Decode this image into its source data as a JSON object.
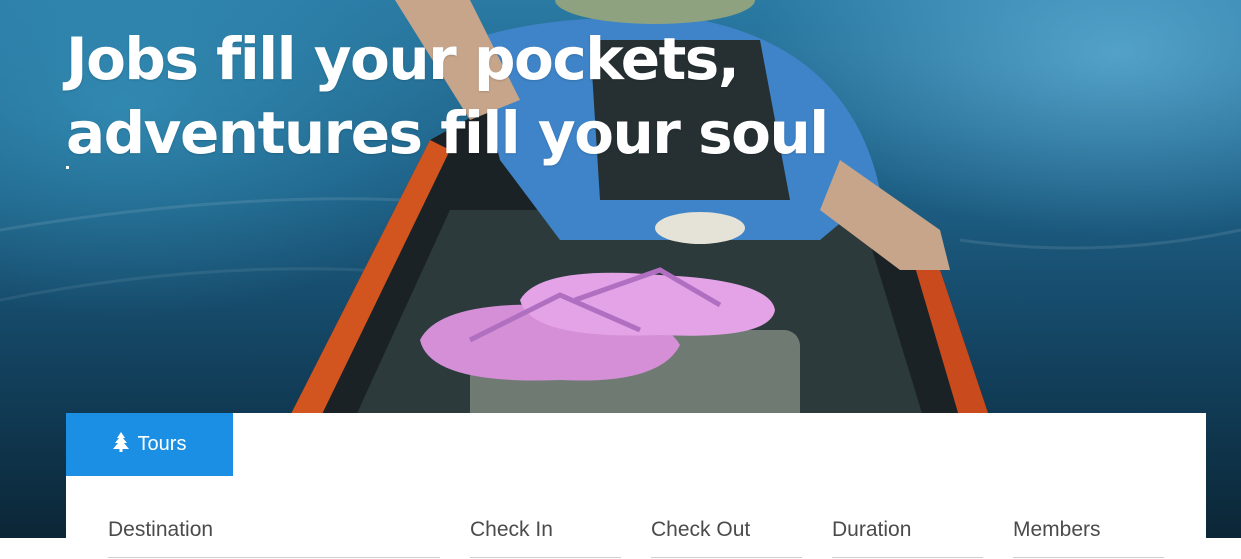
{
  "hero": {
    "headline_line1": "Jobs fill your pockets,",
    "headline_line2": "adventures fill your soul"
  },
  "search": {
    "tabs": [
      {
        "label": "Tours",
        "icon": "tree-icon",
        "active": true
      }
    ],
    "fields": [
      {
        "label": "Destination"
      },
      {
        "label": "Check In"
      },
      {
        "label": "Check Out"
      },
      {
        "label": "Duration"
      },
      {
        "label": "Members"
      }
    ]
  },
  "colors": {
    "accent": "#1a8fe3",
    "headline": "#ffffff",
    "label_text": "#4b4b4b",
    "underline": "#cfcfcf"
  }
}
